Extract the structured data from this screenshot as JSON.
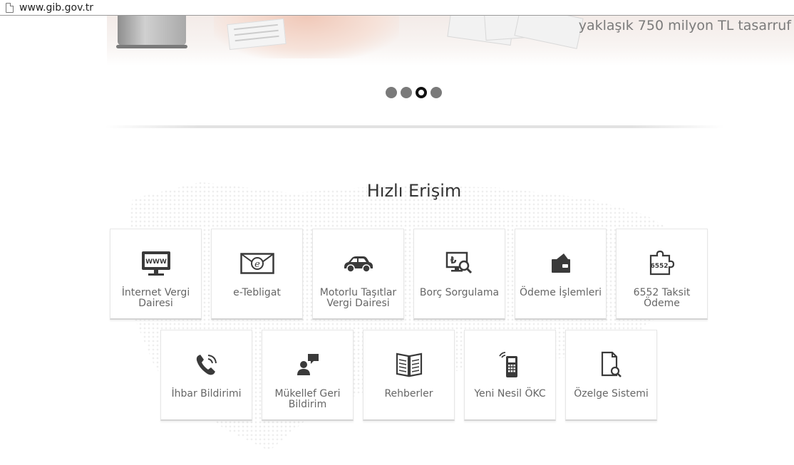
{
  "browser": {
    "url": "www.gib.gov.tr"
  },
  "hero": {
    "caption": "yaklaşık 750 milyon TL tasarruf"
  },
  "slider": {
    "dot_count": 4,
    "active_index": 2
  },
  "quick_access": {
    "title": "Hızlı Erişim",
    "row1": [
      {
        "label": "İnternet Vergi Dairesi",
        "icon": "www-monitor-icon"
      },
      {
        "label": "e-Tebligat",
        "icon": "e-mail-envelope-icon"
      },
      {
        "label": "Motorlu Taşıtlar Vergi Dairesi",
        "icon": "car-icon"
      },
      {
        "label": "Borç Sorgulama",
        "icon": "lira-search-icon"
      },
      {
        "label": "Ödeme İşlemleri",
        "icon": "wallet-card-icon"
      },
      {
        "label": "6552 Taksit Ödeme",
        "icon": "puzzle-6552-icon"
      }
    ],
    "row2": [
      {
        "label": "İhbar Bildirimi",
        "icon": "phone-icon"
      },
      {
        "label": "Mükellef Geri Bildirim",
        "icon": "person-speech-icon"
      },
      {
        "label": "Rehberler",
        "icon": "open-book-icon"
      },
      {
        "label": "Yeni Nesil ÖKC",
        "icon": "pos-terminal-icon"
      },
      {
        "label": "Özelge Sistemi",
        "icon": "document-search-icon"
      }
    ],
    "icon_badge_text": {
      "www": "WWW",
      "taksit": "6552"
    }
  }
}
